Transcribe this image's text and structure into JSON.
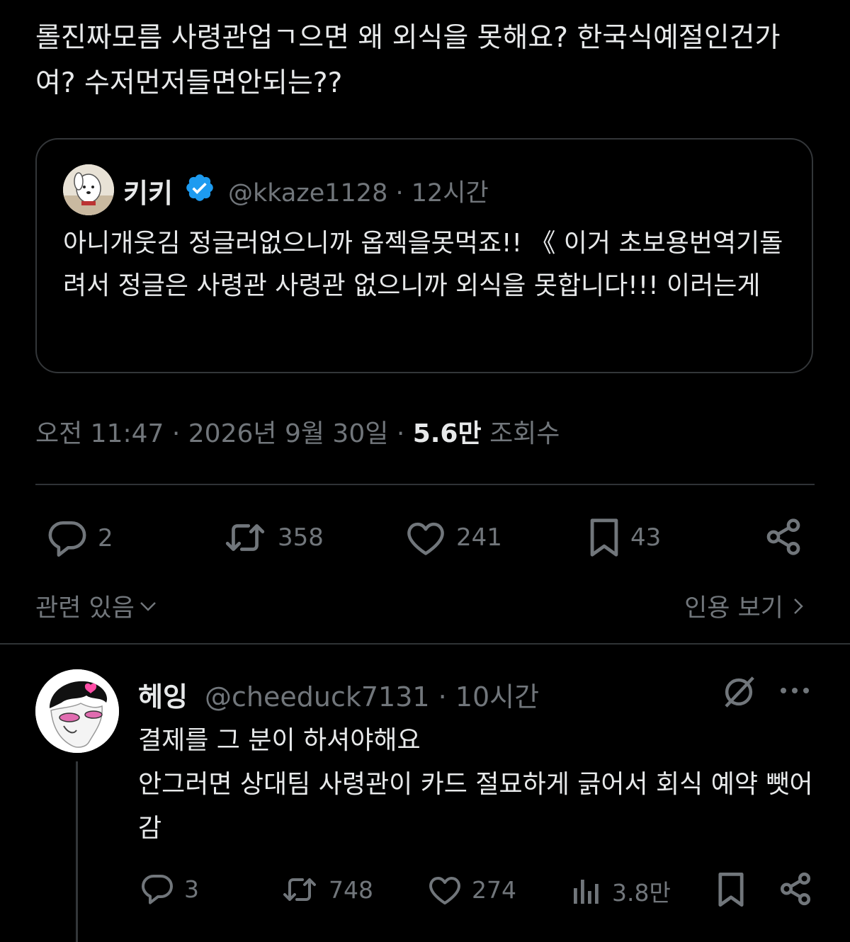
{
  "post": {
    "text": "롤진짜모름 사령관업ㄱ으면 왜 외식을 못해요? 한국식예절인건가여? 수저먼저들면안되는??"
  },
  "quote": {
    "name": "키키",
    "handle": "@kkaze1128",
    "time": "12시간",
    "text": "아니개웃김 정글러없으니까 옵젝을못먹죠!! 《 이거 초보용번역기돌려서 정글은 사령관 사령관 없으니까 외식을 못합니다!!! 이러는게"
  },
  "meta": {
    "time": "오전 11:47",
    "date": "2026년 9월 30일",
    "views_count": "5.6만",
    "views_label": "조회수"
  },
  "actions": {
    "replies": "2",
    "reposts": "358",
    "likes": "241",
    "bookmarks": "43"
  },
  "links": {
    "related": "관련 있음",
    "see_quotes": "인용 보기"
  },
  "reply": {
    "name": "헤잉",
    "handle": "@cheeduck7131",
    "time": "10시간",
    "lines": [
      "결제를 그 분이 하셔야해요",
      "안그러면 상대팀 사령관이 카드 절묘하게 긁어서 회식 예약 뺏어감"
    ],
    "replies": "3",
    "reposts": "748",
    "likes": "274",
    "views": "3.8만"
  },
  "colors": {
    "background": "#000000",
    "text": "#e7e9ea",
    "muted": "#71767b",
    "verified": "#1d9bf0",
    "border": "#2f3336"
  }
}
